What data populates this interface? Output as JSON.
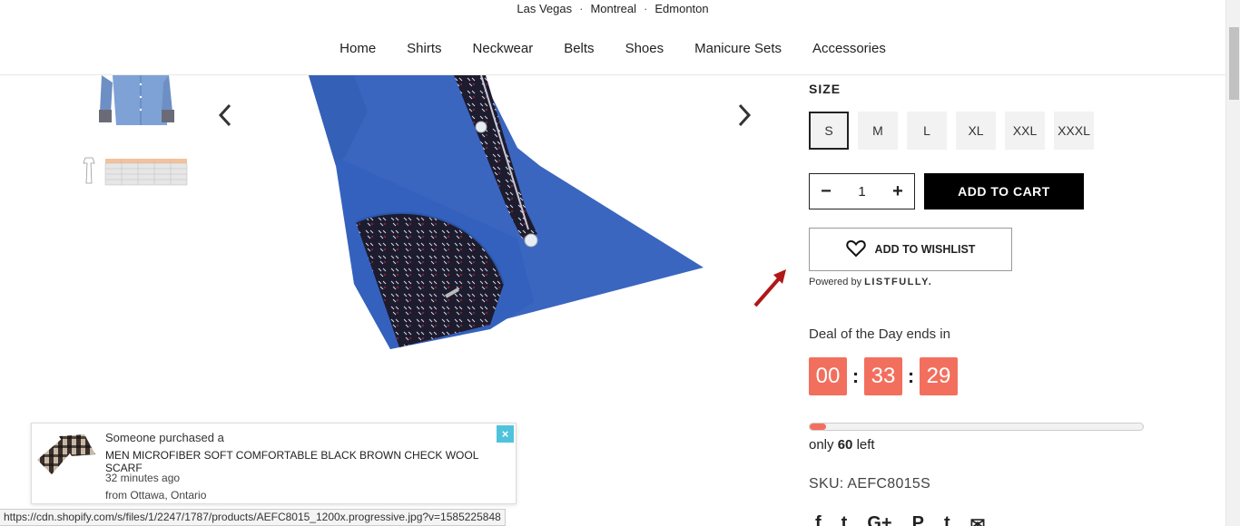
{
  "header": {
    "locations": [
      "Las Vegas",
      "Montreal",
      "Edmonton"
    ],
    "nav": [
      "Home",
      "Shirts",
      "Neckwear",
      "Belts",
      "Shoes",
      "Manicure Sets",
      "Accessories"
    ]
  },
  "product": {
    "size_label": "SIZE",
    "sizes": [
      "S",
      "M",
      "L",
      "XL",
      "XXL",
      "XXXL"
    ],
    "selected_size": "S",
    "quantity": "1",
    "qty_minus": "−",
    "qty_plus": "+",
    "add_to_cart": "ADD TO CART",
    "wishlist": "ADD TO WISHLIST",
    "powered_by_prefix": "Powered by",
    "powered_by_brand": "LISTFULLY.",
    "deal_text": "Deal of the Day ends in",
    "timer": {
      "hours": "00",
      "minutes": "33",
      "seconds": "29",
      "separator": ":"
    },
    "stock_prefix": "only",
    "stock_count": "60",
    "stock_suffix": "left",
    "stock_level": 0.05,
    "sku": "SKU: AEFC8015S",
    "social_icons": [
      "facebook-icon",
      "twitter-icon",
      "google-plus-icon",
      "pinterest-icon",
      "tumblr-icon",
      "email-icon"
    ],
    "social_glyphs": [
      "f",
      "t",
      "G+",
      "P",
      "t",
      "✉"
    ]
  },
  "gallery": {
    "prev": "‹",
    "next": "›"
  },
  "popup": {
    "line1": "Someone purchased a",
    "title": "MEN MICROFIBER SOFT COMFORTABLE BLACK BROWN CHECK WOOL SCARF",
    "time": "32 minutes ago",
    "location": "from Ottawa, Ontario",
    "close": "×"
  },
  "statusbar": {
    "url": "https://cdn.shopify.com/s/files/1/2247/1787/products/AEFC8015_1200x.progressive.jpg?v=1585225848"
  },
  "colors": {
    "accent": "#f26f5e",
    "cart_bg": "#000000",
    "popup_close": "#4fc3db"
  }
}
